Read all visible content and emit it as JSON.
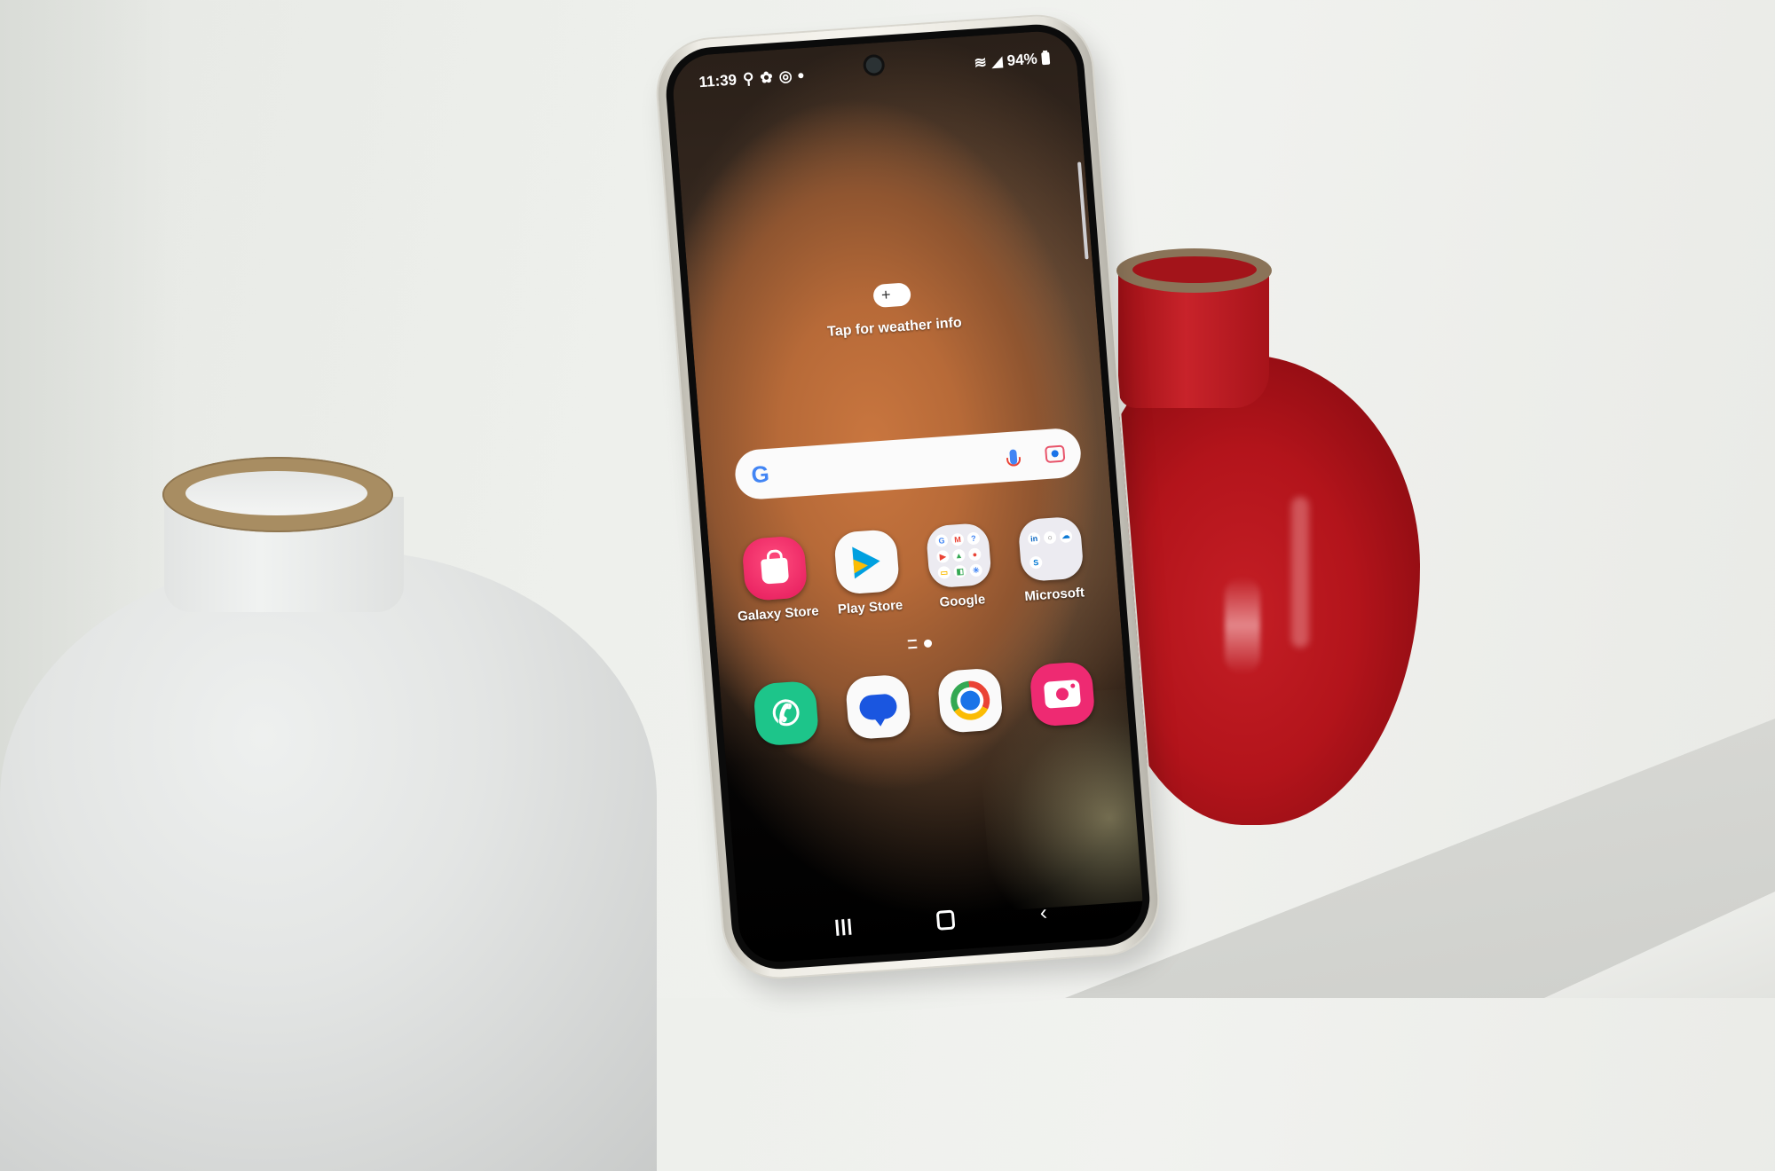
{
  "scene": {
    "description": "Samsung Galaxy phone leaning against wall between white and red vases",
    "colors": {
      "wall": "#eef0ec",
      "white_vase": "#e3e5e4",
      "white_vase_rim": "#a88d62",
      "red_vase": "#b3141b",
      "red_vase_rim": "#8a7358",
      "phone_frame": "#f2f0ea"
    }
  },
  "status_bar": {
    "time": "11:39",
    "left_icons": [
      "location-pin-icon",
      "gear-icon",
      "circle-target-icon",
      "notification-dot-icon"
    ],
    "right_icons": [
      "wifi-icon",
      "signal-icon",
      "battery-icon"
    ],
    "battery": "94%"
  },
  "weather_widget": {
    "icon": "cloud-sun-plus-icon",
    "text": "Tap for weather info"
  },
  "search_bar": {
    "logo": "G",
    "mic_icon": "mic-icon",
    "lens_icon": "lens-icon"
  },
  "apps": [
    {
      "label": "Galaxy Store",
      "icon": "shopping-bag-icon",
      "color": "#e51a5c"
    },
    {
      "label": "Play Store",
      "icon": "play-triangle-icon",
      "color": "#fafafa"
    },
    {
      "label": "Google",
      "icon": "folder-icon",
      "color": "#ecebf1",
      "folder_items": [
        "G",
        "M",
        "?",
        "▶",
        "▲",
        "●",
        "▭",
        "◧",
        "✳"
      ]
    },
    {
      "label": "Microsoft",
      "icon": "folder-icon",
      "color": "#ecebf1",
      "folder_items": [
        "in",
        "○",
        "☁",
        "S"
      ]
    }
  ],
  "dock": [
    {
      "name": "Phone",
      "icon": "phone-icon",
      "color": "#1dc58a"
    },
    {
      "name": "Messages",
      "icon": "message-bubble-icon",
      "color": "#fafafa"
    },
    {
      "name": "Chrome",
      "icon": "chrome-icon",
      "color": "#fafafa"
    },
    {
      "name": "Camera",
      "icon": "camera-icon",
      "color": "#ee2a72"
    }
  ],
  "page_indicator": {
    "pages": 2,
    "current": 2
  },
  "navigation": {
    "recents": "recents-icon",
    "home": "home-icon",
    "back": "‹"
  },
  "glyphs": {
    "phone": "✆",
    "plus": "+"
  }
}
